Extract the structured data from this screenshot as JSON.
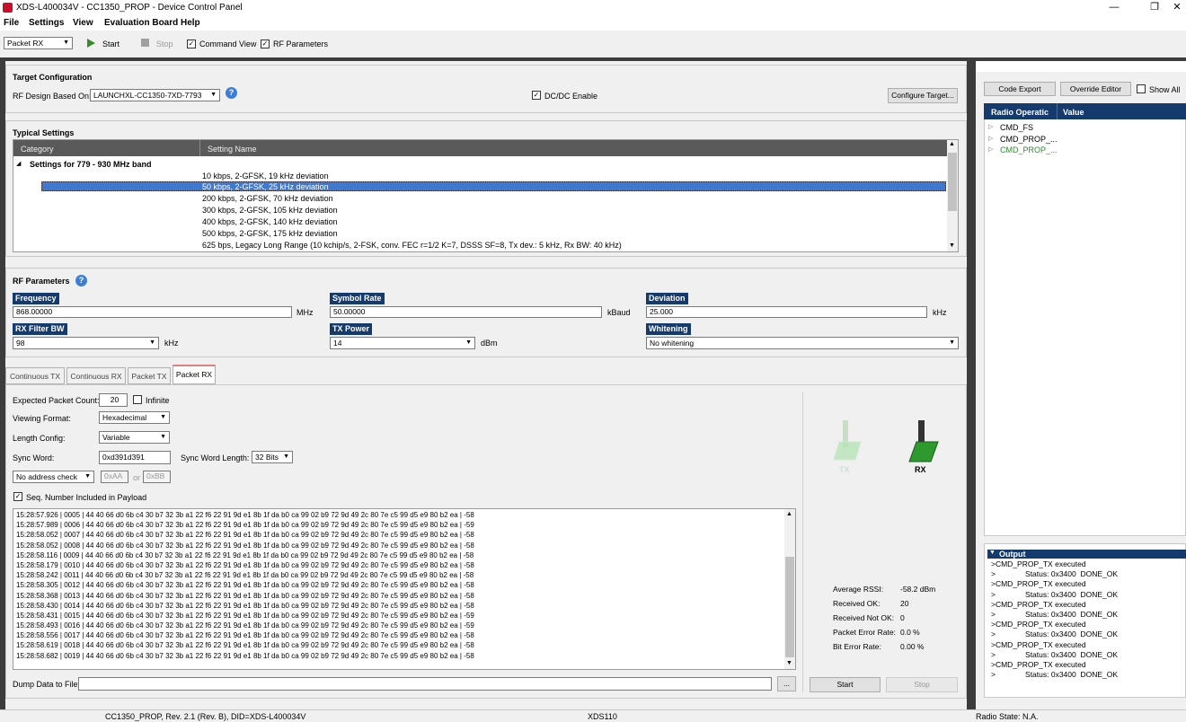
{
  "window": {
    "title": "XDS-L400034V - CC1350_PROP - Device Control Panel",
    "min": "—",
    "max": "❐",
    "close": "✕"
  },
  "menu": {
    "file": "File",
    "settings": "Settings",
    "view": "View",
    "evaluation_board": "Evaluation Board",
    "help": "Help"
  },
  "toolbar": {
    "mode": "Packet RX",
    "start": "Start",
    "stop": "Stop",
    "command_view": "Command View",
    "rf_parameters": "RF Parameters"
  },
  "target": {
    "title": "Target Configuration",
    "rf_design_label": "RF Design Based On:",
    "rf_design_value": "LAUNCHXL-CC1350-7XD-7793",
    "dcdc": "DC/DC Enable",
    "configure": "Configure Target..."
  },
  "typical": {
    "title": "Typical Settings",
    "col_category": "Category",
    "col_setting": "Setting Name",
    "group": "Settings for 779 - 930 MHz band",
    "rows": [
      "10 kbps, 2-GFSK, 19 kHz deviation",
      "50 kbps, 2-GFSK, 25 kHz deviation",
      "200 kbps, 2-GFSK, 70 kHz deviation",
      "300 kbps, 2-GFSK, 105 kHz deviation",
      "400 kbps, 2-GFSK, 140 kHz deviation",
      "500 kbps, 2-GFSK, 175 kHz deviation",
      "625 bps, Legacy Long Range (10 kchip/s, 2-FSK, conv. FEC r=1/2 K=7, DSSS SF=8, Tx dev.: 5 kHz, Rx BW: 40 kHz)"
    ]
  },
  "rf": {
    "title": "RF Parameters",
    "frequency_label": "Frequency",
    "frequency": "868.00000",
    "frequency_unit": "MHz",
    "symbol_rate_label": "Symbol Rate",
    "symbol_rate": "50.00000",
    "symbol_rate_unit": "kBaud",
    "deviation_label": "Deviation",
    "deviation": "25.000",
    "deviation_unit": "kHz",
    "rx_filter_label": "RX Filter BW",
    "rx_filter": "98",
    "rx_filter_unit": "kHz",
    "tx_power_label": "TX Power",
    "tx_power": "14",
    "tx_power_unit": "dBm",
    "whitening_label": "Whitening",
    "whitening": "No whitening"
  },
  "tabs": [
    "Continuous TX",
    "Continuous RX",
    "Packet TX",
    "Packet RX"
  ],
  "packet": {
    "expected_label": "Expected Packet Count:",
    "expected": "20",
    "infinite": "Infinite",
    "viewing_label": "Viewing Format:",
    "viewing": "Hexadecimal",
    "length_label": "Length Config:",
    "length": "Variable",
    "sync_label": "Sync Word:",
    "sync": "0xd391d391",
    "sync_len_label": "Sync Word Length:",
    "sync_len": "32 Bits",
    "address": "No address check",
    "addr1": "0xAA",
    "or": "or",
    "addr2": "0xBB",
    "seq": "Seq. Number Included in Payload",
    "log": [
      "15:28:57.926 | 0005 | 44 40 66 d0 6b c4 30 b7 32 3b a1 22 f6 22 91 9d e1 8b 1f da b0 ca 99 02 b9 72 9d 49 2c 80 7e c5 99 d5 e9 80 b2 ea  |  -58",
      "15:28:57.989 | 0006 | 44 40 66 d0 6b c4 30 b7 32 3b a1 22 f6 22 91 9d e1 8b 1f da b0 ca 99 02 b9 72 9d 49 2c 80 7e c5 99 d5 e9 80 b2 ea  |  -59",
      "15:28:58.052 | 0007 | 44 40 66 d0 6b c4 30 b7 32 3b a1 22 f6 22 91 9d e1 8b 1f da b0 ca 99 02 b9 72 9d 49 2c 80 7e c5 99 d5 e9 80 b2 ea  |  -58",
      "15:28:58.052 | 0008 | 44 40 66 d0 6b c4 30 b7 32 3b a1 22 f6 22 91 9d e1 8b 1f da b0 ca 99 02 b9 72 9d 49 2c 80 7e c5 99 d5 e9 80 b2 ea  |  -58",
      "15:28:58.116 | 0009 | 44 40 66 d0 6b c4 30 b7 32 3b a1 22 f6 22 91 9d e1 8b 1f da b0 ca 99 02 b9 72 9d 49 2c 80 7e c5 99 d5 e9 80 b2 ea  |  -58",
      "15:28:58.179 | 0010 | 44 40 66 d0 6b c4 30 b7 32 3b a1 22 f6 22 91 9d e1 8b 1f da b0 ca 99 02 b9 72 9d 49 2c 80 7e c5 99 d5 e9 80 b2 ea  |  -58",
      "15:28:58.242 | 0011 | 44 40 66 d0 6b c4 30 b7 32 3b a1 22 f6 22 91 9d e1 8b 1f da b0 ca 99 02 b9 72 9d 49 2c 80 7e c5 99 d5 e9 80 b2 ea  |  -58",
      "15:28:58.305 | 0012 | 44 40 66 d0 6b c4 30 b7 32 3b a1 22 f6 22 91 9d e1 8b 1f da b0 ca 99 02 b9 72 9d 49 2c 80 7e c5 99 d5 e9 80 b2 ea  |  -58",
      "15:28:58.368 | 0013 | 44 40 66 d0 6b c4 30 b7 32 3b a1 22 f6 22 91 9d e1 8b 1f da b0 ca 99 02 b9 72 9d 49 2c 80 7e c5 99 d5 e9 80 b2 ea  |  -58",
      "15:28:58.430 | 0014 | 44 40 66 d0 6b c4 30 b7 32 3b a1 22 f6 22 91 9d e1 8b 1f da b0 ca 99 02 b9 72 9d 49 2c 80 7e c5 99 d5 e9 80 b2 ea  |  -58",
      "15:28:58.431 | 0015 | 44 40 66 d0 6b c4 30 b7 32 3b a1 22 f6 22 91 9d e1 8b 1f da b0 ca 99 02 b9 72 9d 49 2c 80 7e c5 99 d5 e9 80 b2 ea  |  -59",
      "15:28:58.493 | 0016 | 44 40 66 d0 6b c4 30 b7 32 3b a1 22 f6 22 91 9d e1 8b 1f da b0 ca 99 02 b9 72 9d 49 2c 80 7e c5 99 d5 e9 80 b2 ea  |  -59",
      "15:28:58.556 | 0017 | 44 40 66 d0 6b c4 30 b7 32 3b a1 22 f6 22 91 9d e1 8b 1f da b0 ca 99 02 b9 72 9d 49 2c 80 7e c5 99 d5 e9 80 b2 ea  |  -58",
      "15:28:58.619 | 0018 | 44 40 66 d0 6b c4 30 b7 32 3b a1 22 f6 22 91 9d e1 8b 1f da b0 ca 99 02 b9 72 9d 49 2c 80 7e c5 99 d5 e9 80 b2 ea  |  -58",
      "15:28:58.682 | 0019 | 44 40 66 d0 6b c4 30 b7 32 3b a1 22 f6 22 91 9d e1 8b 1f da b0 ca 99 02 b9 72 9d 49 2c 80 7e c5 99 d5 e9 80 b2 ea  |  -58"
    ],
    "dump_label": "Dump Data to File:",
    "browse": "...",
    "start": "Start",
    "stop": "Stop",
    "tx_label": "TX",
    "rx_label": "RX",
    "avg_rssi_label": "Average RSSI:",
    "avg_rssi": "-58.2 dBm",
    "ok_label": "Received OK:",
    "ok": "20",
    "notok_label": "Received Not OK:",
    "notok": "0",
    "per_label": "Packet Error Rate:",
    "per": "0.0 %",
    "ber_label": "Bit Error Rate:",
    "ber": "0.00 %"
  },
  "right": {
    "code_export": "Code Export",
    "override_editor": "Override Editor",
    "show_all": "Show All",
    "col_radio": "Radio Operatic",
    "col_value": "Value",
    "commands": [
      "CMD_FS",
      "CMD_PROP_...",
      "CMD_PROP_..."
    ]
  },
  "output": {
    "title": "Output",
    "lines": [
      ">CMD_PROP_TX executed",
      ">              Status: 0x3400  DONE_OK",
      ">CMD_PROP_TX executed",
      ">              Status: 0x3400  DONE_OK",
      ">CMD_PROP_TX executed",
      ">              Status: 0x3400  DONE_OK",
      ">CMD_PROP_TX executed",
      ">              Status: 0x3400  DONE_OK",
      ">CMD_PROP_TX executed",
      ">              Status: 0x3400  DONE_OK",
      ">CMD_PROP_TX executed",
      ">              Status: 0x3400  DONE_OK"
    ]
  },
  "status": {
    "device": "CC1350_PROP, Rev. 2.1 (Rev. B), DID=XDS-L400034V",
    "probe": "XDS110",
    "radio_state": "Radio State: N.A."
  },
  "colors": {
    "accent": "#153a6e",
    "selected": "#3f78d0",
    "green": "#2e7d2e"
  }
}
